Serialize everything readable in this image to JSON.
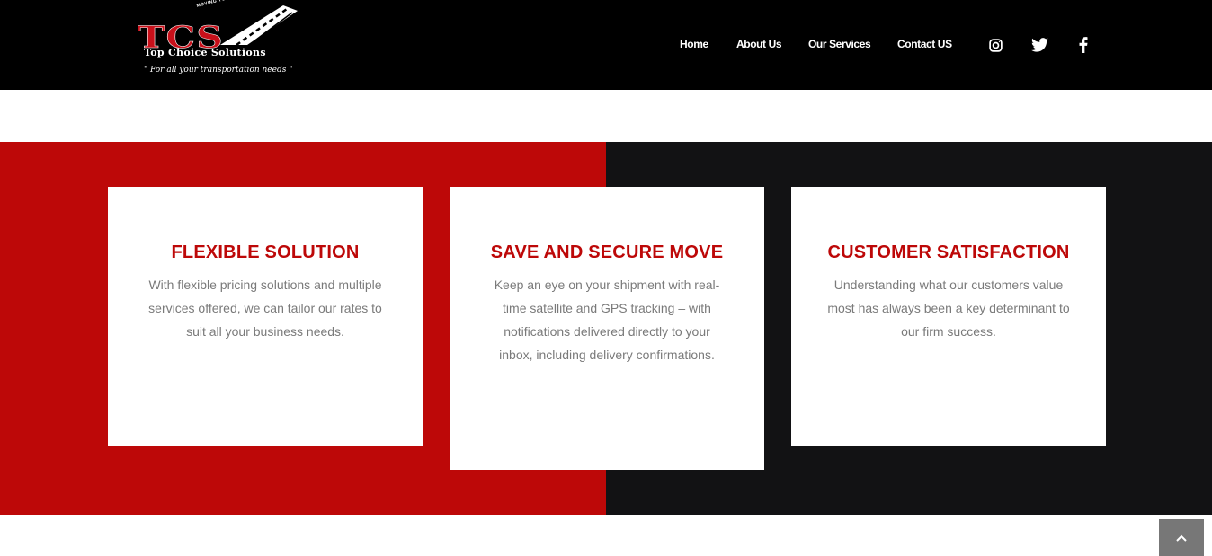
{
  "brand": {
    "logo_text": "TCS",
    "company_name": "Top Choice Solutions",
    "slogan": "\" For all your transportation needs \"",
    "tagline": "MOVING YOUR BUSINESS FORWARD"
  },
  "nav": {
    "items": [
      {
        "label": "Home"
      },
      {
        "label": "About Us"
      },
      {
        "label": "Our Services"
      },
      {
        "label": "Contact US"
      }
    ],
    "social": [
      {
        "icon": "instagram-icon"
      },
      {
        "icon": "twitter-icon"
      },
      {
        "icon": "facebook-icon"
      }
    ]
  },
  "features": [
    {
      "title": "FLEXIBLE SOLUTION",
      "text": "With flexible pricing solutions and multiple services offered, we can tailor our rates to suit all your business needs."
    },
    {
      "title": "SAVE AND SECURE MOVE",
      "text": "Keep an eye on your shipment with real-time satellite and GPS tracking – with notifications delivered directly to your inbox, including delivery confirmations."
    },
    {
      "title": "CUSTOMER SATISFACTION",
      "text": "Understanding what our customers value most has always been a key determinant to our firm success."
    }
  ],
  "scroll_top": {
    "icon": "chevron-up-icon"
  },
  "colors": {
    "header_bg": "#000000",
    "accent_red": "#bd0808",
    "dark_panel": "#121214",
    "body_text": "#7a7a7a"
  }
}
